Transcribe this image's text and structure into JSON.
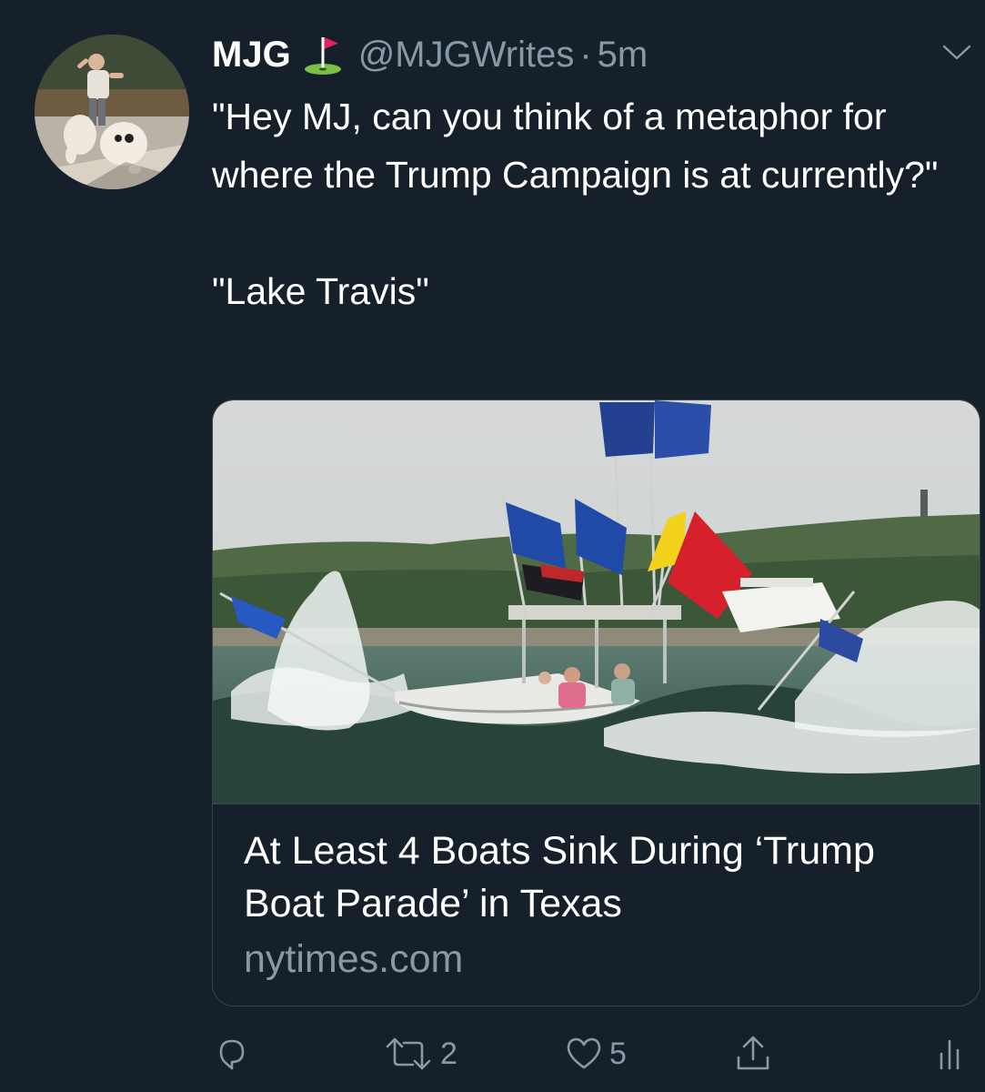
{
  "tweet": {
    "display_name": "MJG",
    "emoji": "golf-flag",
    "handle": "@MJGWrites",
    "separator": "·",
    "time": "5m",
    "text": "\"Hey MJ, can you think of a metaphor for where the Trump Campaign is at currently?\"\n\n\"Lake Travis\""
  },
  "card": {
    "title": "At Least 4 Boats Sink During ‘Trump Boat Parade’ in Texas",
    "domain": "nytimes.com",
    "image_description_icon": "photo-boats-with-flags"
  },
  "actions": {
    "reply_icon": "reply-icon",
    "retweet_count": "2",
    "like_count": "5",
    "share_icon": "share-icon",
    "analytics_icon": "analytics-icon"
  },
  "colors": {
    "background": "#15202b",
    "secondary_text": "#8899a6",
    "border": "#38444d"
  }
}
